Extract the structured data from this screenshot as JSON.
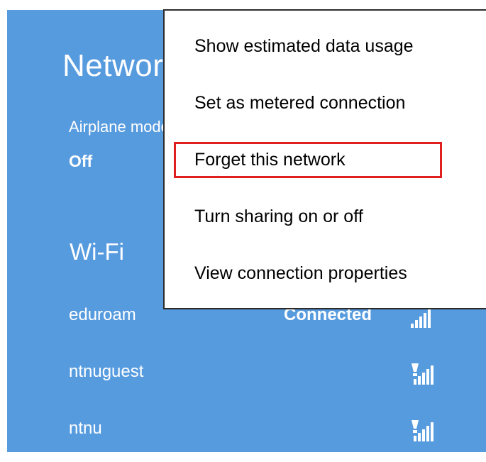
{
  "panel": {
    "title": "Networks",
    "airplane_mode": {
      "label": "Airplane mode",
      "value": "Off"
    },
    "wifi_heading": "Wi-Fi",
    "networks": [
      {
        "name": "eduroam",
        "status": "Connected",
        "icon": "wifi-signal-icon"
      },
      {
        "name": "ntnuguest",
        "status": "",
        "icon": "wifi-signal-warning-icon"
      },
      {
        "name": "ntnu",
        "status": "",
        "icon": "wifi-signal-warning-icon"
      }
    ]
  },
  "context_menu": {
    "items": [
      "Show estimated data usage",
      "Set as metered connection",
      "Forget this network",
      "Turn sharing on or off",
      "View connection properties"
    ],
    "highlighted": "Forget this network"
  },
  "colors": {
    "panel_bg": "#579bdf",
    "highlight_border": "#e02020",
    "menu_border": "#2b2b2b"
  }
}
